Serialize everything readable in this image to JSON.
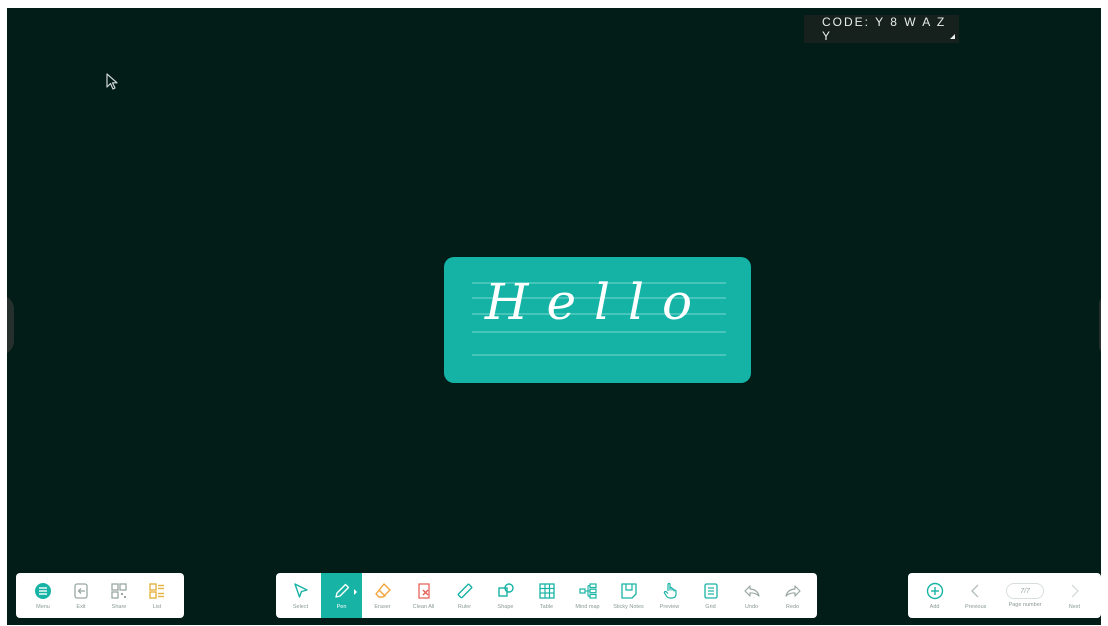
{
  "session": {
    "code_label": "CODE: Y 8 W A Z Y"
  },
  "card": {
    "word": "Hello"
  },
  "colors": {
    "board": "#021d18",
    "accent": "#17b3a4",
    "card": "#14b3a6",
    "toolbar": "#ffffff",
    "list_icon": "#e3b341"
  },
  "left_toolbar": [
    {
      "label": "Menu",
      "icon": "menu-icon"
    },
    {
      "label": "Exit",
      "icon": "exit-icon"
    },
    {
      "label": "Share",
      "icon": "qr-code-icon"
    },
    {
      "label": "List",
      "icon": "list-icon"
    }
  ],
  "main_toolbar": [
    {
      "label": "Select",
      "icon": "select-arrow-icon"
    },
    {
      "label": "Pen",
      "icon": "pen-icon",
      "active": true
    },
    {
      "label": "Eraser",
      "icon": "eraser-icon"
    },
    {
      "label": "Clean All",
      "icon": "clean-all-icon"
    },
    {
      "label": "Ruler",
      "icon": "ruler-icon"
    },
    {
      "label": "Shape",
      "icon": "shape-icon"
    },
    {
      "label": "Table",
      "icon": "table-icon"
    },
    {
      "label": "Mind map",
      "icon": "mind-map-icon"
    },
    {
      "label": "Sticky Notes",
      "icon": "sticky-notes-icon"
    },
    {
      "label": "Preview",
      "icon": "preview-hand-icon"
    },
    {
      "label": "Grid",
      "icon": "grid-icon"
    },
    {
      "label": "Undo",
      "icon": "undo-icon"
    },
    {
      "label": "Redo",
      "icon": "redo-icon"
    }
  ],
  "right_toolbar": {
    "add_label": "Add",
    "previous_label": "Previous",
    "page_value": "7/7",
    "page_label": "Page number",
    "next_label": "Next"
  }
}
